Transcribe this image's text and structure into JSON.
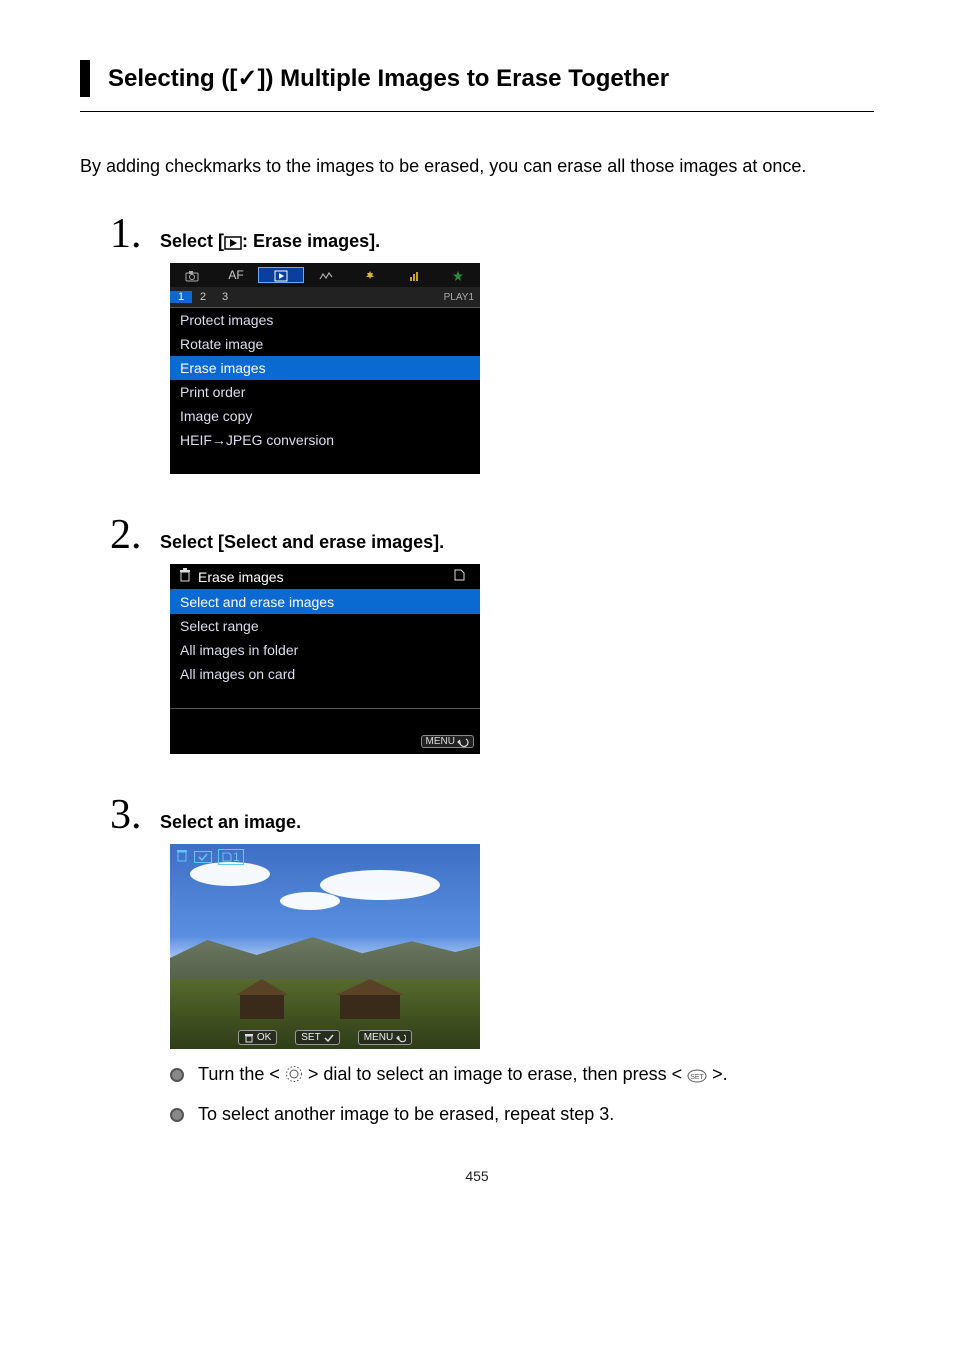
{
  "title": "Selecting ([✓]) Multiple Images to Erase Together",
  "intro": "By adding checkmarks to the images to be erased, you can erase all those images at once.",
  "page_number": "455",
  "step1": {
    "num": "1.",
    "title_pre": "Select [",
    "title_post": ": Erase images].",
    "tabs": {
      "af": "AF"
    },
    "subtabs": {
      "t1": "1",
      "t2": "2",
      "t3": "3",
      "tag": "PLAY1"
    },
    "items": {
      "protect": "Protect images",
      "rotate": "Rotate image",
      "erase": "Erase images",
      "print": "Print order",
      "copy": "Image copy",
      "heif": "HEIF→JPEG conversion"
    }
  },
  "step2": {
    "num": "2.",
    "title": "Select [Select and erase images].",
    "header": "Erase images",
    "items": {
      "select": "Select and erase images",
      "range": "Select range",
      "folder": "All images in folder",
      "card": "All images on card"
    },
    "menu": "MENU"
  },
  "step3": {
    "num": "3.",
    "title": "Select an image.",
    "overlay_count": "1",
    "btn_ok": "OK",
    "btn_set": "SET",
    "btn_menu": "MENU",
    "bullet1_pre": "Turn the < ",
    "bullet1_mid": " > dial to select an image to erase, then press < ",
    "bullet1_post": " >.",
    "bullet2": "To select another image to be erased, repeat step 3."
  }
}
